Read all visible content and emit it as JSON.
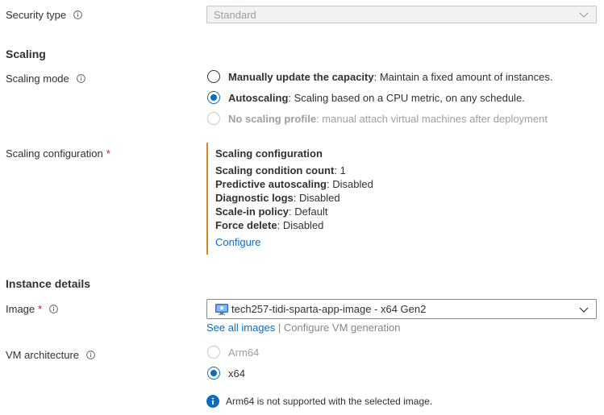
{
  "security_type": {
    "label": "Security type",
    "value": "Standard"
  },
  "scaling": {
    "heading": "Scaling",
    "mode_label": "Scaling mode",
    "options": [
      {
        "bold": "Manually update the capacity",
        "rest": ": Maintain a fixed amount of instances."
      },
      {
        "bold": "Autoscaling",
        "rest": ": Scaling based on a CPU metric, on any schedule."
      },
      {
        "bold": "No scaling profile",
        "rest": ": manual attach virtual machines after deployment"
      }
    ],
    "config_label": "Scaling configuration",
    "required_mark": "*",
    "config": {
      "title": "Scaling configuration",
      "lines": [
        {
          "key": "Scaling condition count",
          "value": ": 1"
        },
        {
          "key": "Predictive autoscaling",
          "value": ": Disabled"
        },
        {
          "key": "Diagnostic logs",
          "value": ": Disabled"
        },
        {
          "key": "Scale-in policy",
          "value": ": Default"
        },
        {
          "key": "Force delete",
          "value": ": Disabled"
        }
      ],
      "configure_link": "Configure"
    }
  },
  "instance": {
    "heading": "Instance details",
    "image_label": "Image",
    "required_mark": "*",
    "image_value": "tech257-tidi-sparta-app-image - x64 Gen2",
    "see_all_images": "See all images",
    "separator": "|",
    "configure_vm_generation": "Configure VM generation",
    "vm_arch_label": "VM architecture",
    "arch_options": [
      "Arm64",
      "x64"
    ],
    "arch_note": "Arm64 is not supported with the selected image."
  },
  "colors": {
    "accent": "#0f6cbd",
    "config_border": "#d68423",
    "required": "#a4262c",
    "disabled_text": "#a19f9d"
  }
}
